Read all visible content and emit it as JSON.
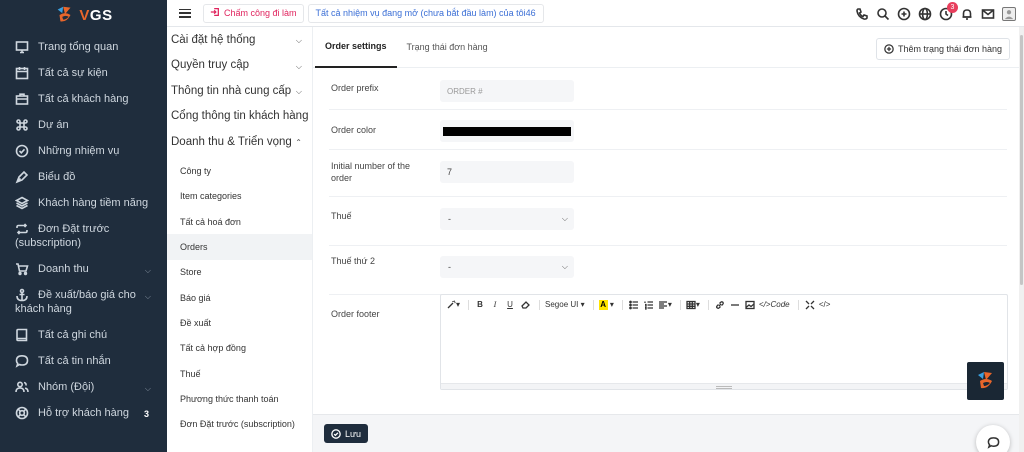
{
  "brand": {
    "name": "VGS",
    "accent": "#e8662b",
    "sidebar_bg": "#1f2d3d"
  },
  "sidebar": {
    "items": [
      {
        "label": "Trang tổng quan",
        "icon": "monitor-icon"
      },
      {
        "label": "Tất cả sự kiện",
        "icon": "calendar-icon"
      },
      {
        "label": "Tất cả khách hàng",
        "icon": "briefcase-icon"
      },
      {
        "label": "Dự án",
        "icon": "command-icon"
      },
      {
        "label": "Những nhiệm vụ",
        "icon": "check-circle-icon"
      },
      {
        "label": "Biểu đồ",
        "icon": "pen-tool-icon"
      },
      {
        "label": "Khách hàng tiềm năng",
        "icon": "layers-icon"
      },
      {
        "label": "Đơn Đặt trước",
        "label2": "(subscription)",
        "icon": "repeat-icon"
      },
      {
        "label": "Doanh thu",
        "icon": "cart-icon",
        "has_chevron": true
      },
      {
        "label": "Đề xuất/báo giá cho",
        "label2": "khách hàng",
        "icon": "anchor-icon",
        "has_chevron": true
      },
      {
        "label": "Tất cả ghi chú",
        "icon": "book-icon"
      },
      {
        "label": "Tất cả tin nhắn",
        "icon": "message-icon"
      },
      {
        "label": "Nhóm (Đội)",
        "icon": "users-icon",
        "has_chevron": true
      },
      {
        "label": "Hỗ trợ khách hàng",
        "icon": "life-buoy-icon",
        "badge": "3"
      }
    ]
  },
  "topbar": {
    "checkin_label": "Chấm công đi làm",
    "tasks_label": "Tất cả nhiệm vụ đang mở (chưa bắt đầu làm) của tôi46",
    "notification_count": "3",
    "icons": [
      "phone-icon",
      "search-icon",
      "plus-circle-icon",
      "globe-icon",
      "clock-icon",
      "bell-icon",
      "mail-icon",
      "avatar"
    ]
  },
  "settings_menu": {
    "groups": [
      {
        "label": "Cài đặt hệ thống",
        "chevron": "down"
      },
      {
        "label": "Quyền truy cập",
        "chevron": "down"
      },
      {
        "label": "Thông tin nhà cung cấp",
        "chevron": "down"
      },
      {
        "label": "Cổng thông tin khách hàng",
        "chevron": ""
      },
      {
        "label": "Doanh thu & Triển vọng",
        "chevron": "up"
      }
    ],
    "subitems": [
      {
        "label": "Công ty"
      },
      {
        "label": "Item categories"
      },
      {
        "label": "Tất cả hoá đơn"
      },
      {
        "label": "Orders",
        "active": true
      },
      {
        "label": "Store"
      },
      {
        "label": "Báo giá"
      },
      {
        "label": "Đề xuất"
      },
      {
        "label": "Tất cả hợp đồng"
      },
      {
        "label": "Thuế"
      },
      {
        "label": "Phương thức thanh toán"
      },
      {
        "label": "Đơn Đặt trước (subscription)"
      }
    ]
  },
  "main": {
    "tabs": [
      {
        "label": "Order settings",
        "active": true
      },
      {
        "label": "Trạng thái đơn hàng",
        "active": false
      }
    ],
    "add_status_label": "Thêm trạng thái đơn hàng",
    "form": {
      "order_prefix": {
        "label": "Order prefix",
        "placeholder": "ORDER #"
      },
      "order_color": {
        "label": "Order color",
        "value": "#000000"
      },
      "initial_number": {
        "label_line1": "Initial number of the",
        "label_line2": "order",
        "value": "7"
      },
      "tax": {
        "label": "Thuế",
        "value": "-"
      },
      "tax2": {
        "label": "Thuế thứ 2",
        "value": "-"
      },
      "order_footer": {
        "label": "Order footer"
      }
    },
    "editor_toolbar": {
      "font_name": "Segoe UI",
      "highlight_letter": "A",
      "code_label": "</>Code",
      "source_label": "</>",
      "bold": "B",
      "italic": "I",
      "underline": "U"
    },
    "save_label": "Lưu"
  }
}
